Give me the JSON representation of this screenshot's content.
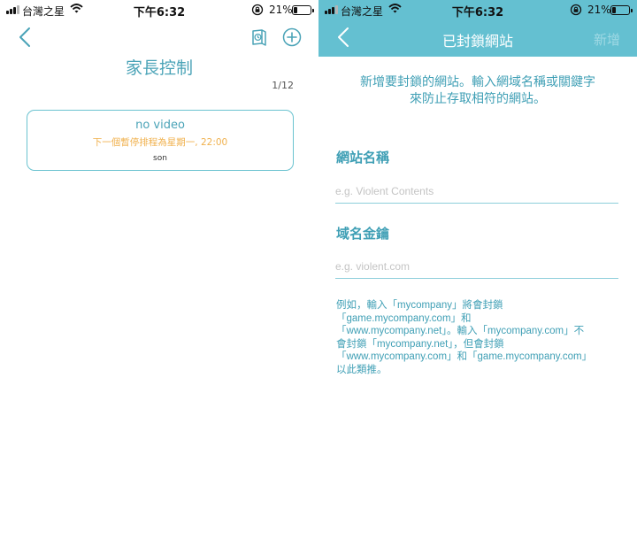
{
  "status_bar": {
    "carrier": "台灣之星",
    "time": "下午6:32",
    "battery": "21%",
    "battery_level": 0.21
  },
  "icons": {
    "back": "back-chevron-icon",
    "schedule": "clock-book-icon",
    "add": "plus-circle-icon",
    "signal": "signal-icon",
    "wifi": "wifi-icon",
    "lock": "orientation-lock-icon",
    "battery": "battery-icon"
  },
  "colors": {
    "accent": "#4aa3b7",
    "header": "#64c0d1",
    "schedule_text": "#f0b14e"
  },
  "left": {
    "title": "家長控制",
    "page_indicator": "1/12",
    "card": {
      "title": "no video",
      "schedule": "下一個暫停排程為星期一, 22:00",
      "owner": "son"
    }
  },
  "right": {
    "header": {
      "title": "已封鎖網站",
      "add_label": "新增"
    },
    "intro": [
      "新增要封鎖的網站。輸入網域名稱或關鍵字",
      "來防止存取相符的網站。"
    ],
    "site_name": {
      "label": "網站名稱",
      "placeholder": "e.g. Violent Contents"
    },
    "domain_key": {
      "label": "域名金鑰",
      "placeholder": "e.g. violent.com"
    },
    "note": [
      "例如，輸入「mycompany」將會封鎖",
      "「game.mycompany.com」和",
      "「www.mycompany.net」。輸入「mycompany.com」不",
      "會封鎖「mycompany.net」，但會封鎖",
      "「www.mycompany.com」和「game.mycompany.com」",
      "以此類推。"
    ]
  }
}
